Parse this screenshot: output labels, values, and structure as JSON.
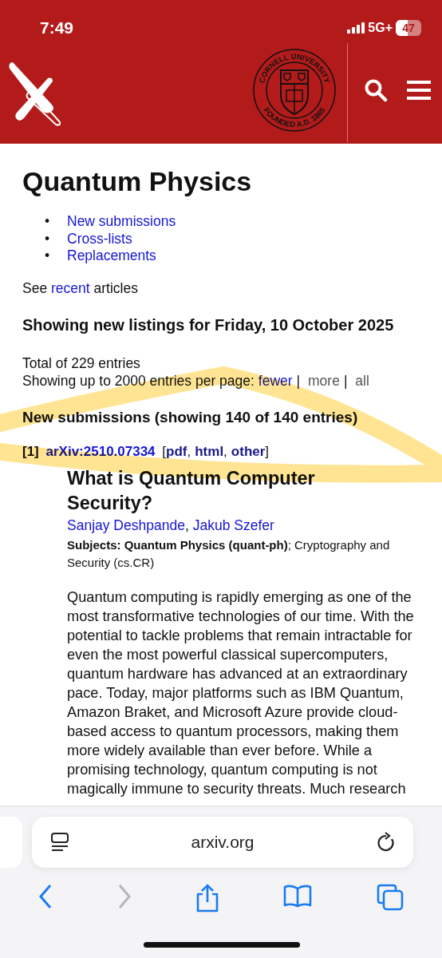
{
  "status_bar": {
    "time": "7:49",
    "network": "5G+",
    "battery": {
      "text": "47",
      "level": 0.47
    }
  },
  "header": {
    "seal_top": "CORNELL UNIVERSITY",
    "seal_bottom": "FOUNDED A.D. 1865"
  },
  "page": {
    "title": "Quantum Physics",
    "nav_links": [
      {
        "marker": "•",
        "label": "New submissions"
      },
      {
        "marker": "•",
        "label": "Cross-lists"
      },
      {
        "marker": "•",
        "label": "Replacements"
      }
    ],
    "recent_line": {
      "before": "See",
      "link": "recent",
      "after": "articles"
    },
    "listing_heading": "Showing new listings for Friday, 10 October 2025",
    "total": "Total of 229 entries",
    "per_page": {
      "text": "Showing up to 2000 entries per page:",
      "options": [
        {
          "label": "fewer",
          "enabled": true
        },
        {
          "label": "more",
          "enabled": false,
          "separator": "|"
        },
        {
          "label": "all",
          "enabled": false,
          "separator": "|"
        }
      ]
    },
    "section_heading": "New submissions (showing 140 of 140 entries)",
    "entries": [
      {
        "index": "[1]",
        "id": "arXiv:2510.07334",
        "open_bracket": "[",
        "close_bracket": "]",
        "formats": [
          {
            "label": "pdf",
            "after": ","
          },
          {
            "label": "html",
            "after": ","
          },
          {
            "label": "other"
          }
        ],
        "title": "What is Quantum Computer Security?",
        "authors": [
          {
            "name": "Sanjay Deshpande",
            "after": ","
          },
          {
            "name": "Jakub Szefer"
          }
        ],
        "subjects": "**Subjects:** **Quantum Physics (quant-ph)**; Cryptography and Security (cs.CR)",
        "abstract": "Quantum computing is rapidly emerging as one of the most transformative technologies of our time. With the potential to tackle problems that remain intractable for even the most powerful classical supercomputers, quantum hardware has advanced at an extraordinary pace. Today, major platforms such as IBM Quantum, Amazon Braket, and Microsoft Azure provide cloud-based access to quantum processors, making them more widely available than ever before. While a promising technology, quantum computing is not magically immune to security threats. Much research"
      }
    ]
  },
  "browser": {
    "url": "arxiv.org",
    "back_enabled": true,
    "forward_enabled": false
  }
}
